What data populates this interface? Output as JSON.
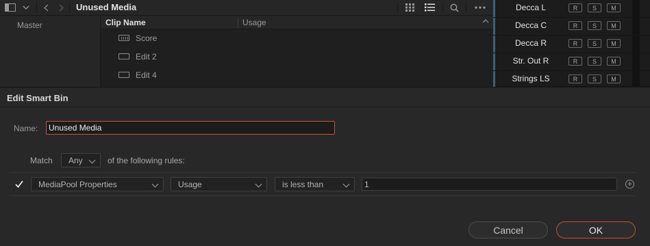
{
  "toolbar": {
    "bin_title": "Unused Media",
    "icons": [
      "sidebar-toggle-icon",
      "chevron-down-icon",
      "back-icon",
      "forward-icon",
      "grid-view-icon",
      "list-view-icon",
      "search-icon",
      "more-icon"
    ]
  },
  "bin_list": {
    "master": "Master"
  },
  "clip_list": {
    "columns": {
      "clip_name": "Clip Name",
      "usage": "Usage"
    },
    "rows": [
      {
        "name": "Score",
        "icon": "timeline-icon"
      },
      {
        "name": "Edit 2",
        "icon": "clip-icon"
      },
      {
        "name": "Edit 4",
        "icon": "clip-icon"
      }
    ]
  },
  "tracks": [
    {
      "name": "Decca L",
      "buttons": [
        "R",
        "S",
        "M"
      ]
    },
    {
      "name": "Decca C",
      "buttons": [
        "R",
        "S",
        "M"
      ]
    },
    {
      "name": "Decca R",
      "buttons": [
        "R",
        "S",
        "M"
      ]
    },
    {
      "name": "Str. Out R",
      "buttons": [
        "R",
        "S",
        "M"
      ]
    },
    {
      "name": "Strings LS",
      "buttons": [
        "R",
        "S",
        "M"
      ]
    }
  ],
  "dialog": {
    "title": "Edit Smart Bin",
    "name_label": "Name:",
    "name_value": "Unused Media",
    "match_label": "Match",
    "match_value": "Any",
    "following_text": "of the following rules:",
    "rule": {
      "checked": true,
      "field_group": "MediaPool Properties",
      "field": "Usage",
      "operator": "is less than",
      "value": "1"
    },
    "cancel_label": "Cancel",
    "ok_label": "OK"
  },
  "colors": {
    "accent": "#d3512f",
    "track_bar": "#3b5f86"
  }
}
